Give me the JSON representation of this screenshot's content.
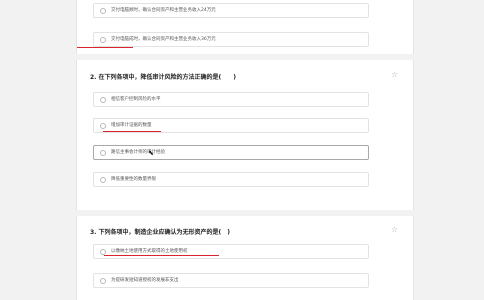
{
  "question_prev": {
    "options": [
      {
        "text": "交付电脑顾时，确认合同资产和主营业务收入24万元"
      },
      {
        "text": "交付电脑成时，确认合同资产和主营业务收入36万元"
      }
    ]
  },
  "question2": {
    "title": "2. 在下列各项中，降低审计风险的方法正确的是(　　)",
    "options": [
      {
        "text": "相信客户控制风险的水平"
      },
      {
        "text": "增加审计证据的数量"
      },
      {
        "text": "路信主事会计师的审计经验"
      },
      {
        "text": "降低重要性的数量界限"
      }
    ]
  },
  "question3": {
    "title": "3. 下列各项中，制造企业应确认为无形资产的是(　)",
    "options": [
      {
        "text": "以缴纳土地使用方式取得的土地使用权"
      },
      {
        "text": "为提研发短知道授权的发展非支出"
      }
    ]
  },
  "icons": {
    "star": "star-icon",
    "cursor": "mouse-cursor-icon"
  },
  "colors": {
    "annotation": "#d8262c",
    "background": "#f2f2f2"
  }
}
